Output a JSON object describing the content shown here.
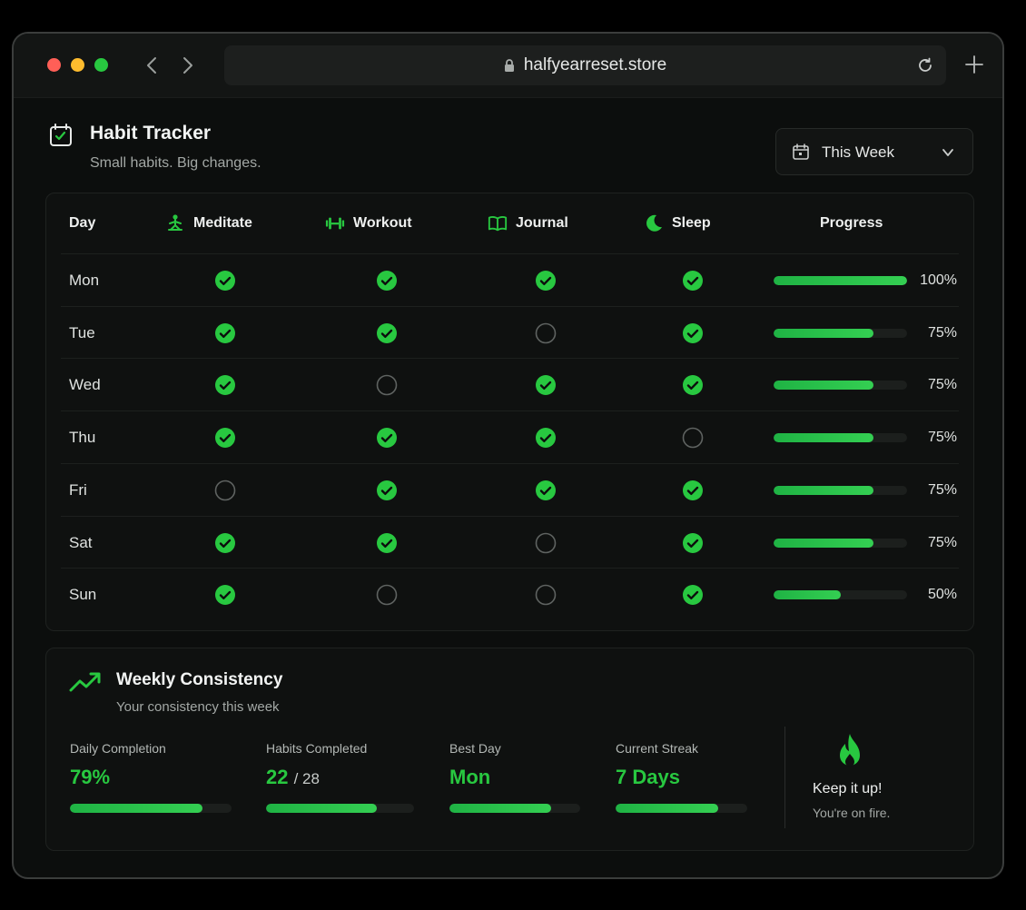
{
  "browser": {
    "url": "halfyearreset.store"
  },
  "header": {
    "title": "Habit Tracker",
    "subtitle": "Small habits. Big changes.",
    "period_selector": "This Week"
  },
  "table": {
    "headers": {
      "day": "Day",
      "meditate": "Meditate",
      "workout": "Workout",
      "journal": "Journal",
      "sleep": "Sleep",
      "progress": "Progress"
    },
    "rows": [
      {
        "day": "Mon",
        "meditate": true,
        "workout": true,
        "journal": true,
        "sleep": true,
        "progress": 100,
        "progress_label": "100%"
      },
      {
        "day": "Tue",
        "meditate": true,
        "workout": true,
        "journal": false,
        "sleep": true,
        "progress": 75,
        "progress_label": "75%"
      },
      {
        "day": "Wed",
        "meditate": true,
        "workout": false,
        "journal": true,
        "sleep": true,
        "progress": 75,
        "progress_label": "75%"
      },
      {
        "day": "Thu",
        "meditate": true,
        "workout": true,
        "journal": true,
        "sleep": false,
        "progress": 75,
        "progress_label": "75%"
      },
      {
        "day": "Fri",
        "meditate": false,
        "workout": true,
        "journal": true,
        "sleep": true,
        "progress": 75,
        "progress_label": "75%"
      },
      {
        "day": "Sat",
        "meditate": true,
        "workout": true,
        "journal": false,
        "sleep": true,
        "progress": 75,
        "progress_label": "75%"
      },
      {
        "day": "Sun",
        "meditate": true,
        "workout": false,
        "journal": false,
        "sleep": true,
        "progress": 50,
        "progress_label": "50%"
      }
    ]
  },
  "consistency": {
    "title": "Weekly Consistency",
    "subtitle": "Your consistency this week",
    "stats": [
      {
        "label": "Daily Completion",
        "value": "79%",
        "of": "",
        "fill": 0.82
      },
      {
        "label": "Habits Completed",
        "value": "22",
        "of": "/ 28",
        "fill": 0.75
      },
      {
        "label": "Best Day",
        "value": "Mon",
        "of": "",
        "fill": 0.78
      },
      {
        "label": "Current Streak",
        "value": "7 Days",
        "of": "",
        "fill": 0.78
      }
    ],
    "motivation_title": "Keep it up!",
    "motivation_sub": "You're on fire."
  },
  "colors": {
    "accent": "#28c840",
    "background": "#0c0e0d",
    "card": "#0f1110"
  },
  "icons": {
    "meditate": "meditate-icon",
    "workout": "dumbbell-icon",
    "journal": "book-icon",
    "sleep": "moon-icon",
    "trend": "trend-up-icon",
    "fire": "fire-icon"
  }
}
